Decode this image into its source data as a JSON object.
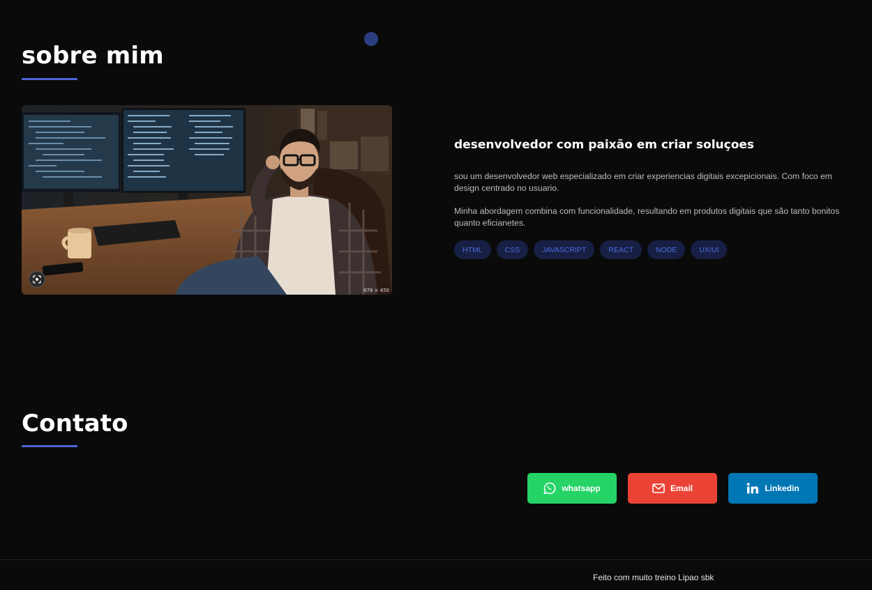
{
  "about": {
    "title": "sobre mim",
    "heading": "desenvolvedor com paixão em criar soluçoes",
    "paragraph1": "sou um desenvolvedor web especializado em criar experiencias digitais excepicionais. Com foco em design centrado no usuario.",
    "paragraph2": "Minha abordagem combina com funcionalidade, resultando em produtos digitais que são tanto bonitos quanto eficianetes.",
    "skills": [
      "HTML",
      "CSS",
      "JAVASCRIPT",
      "REACT",
      "NODE",
      "UX/UI"
    ],
    "photo": {
      "dimensions_label": "878 × 450"
    }
  },
  "contact": {
    "title": "Contato",
    "buttons": [
      {
        "label": "whatsapp",
        "icon": "whatsapp-icon",
        "color": "#25d366"
      },
      {
        "label": "Email",
        "icon": "mail-icon",
        "color": "#ea4335"
      },
      {
        "label": "Linkedin",
        "icon": "linkedin-icon",
        "color": "#0077b5"
      }
    ]
  },
  "footer": {
    "text": "Feito com muito treino Lipao sbk"
  },
  "colors": {
    "background": "#0a0a0a",
    "accent": "#4f63d8",
    "chip_bg": "#172044",
    "chip_text": "#4e6be3"
  }
}
